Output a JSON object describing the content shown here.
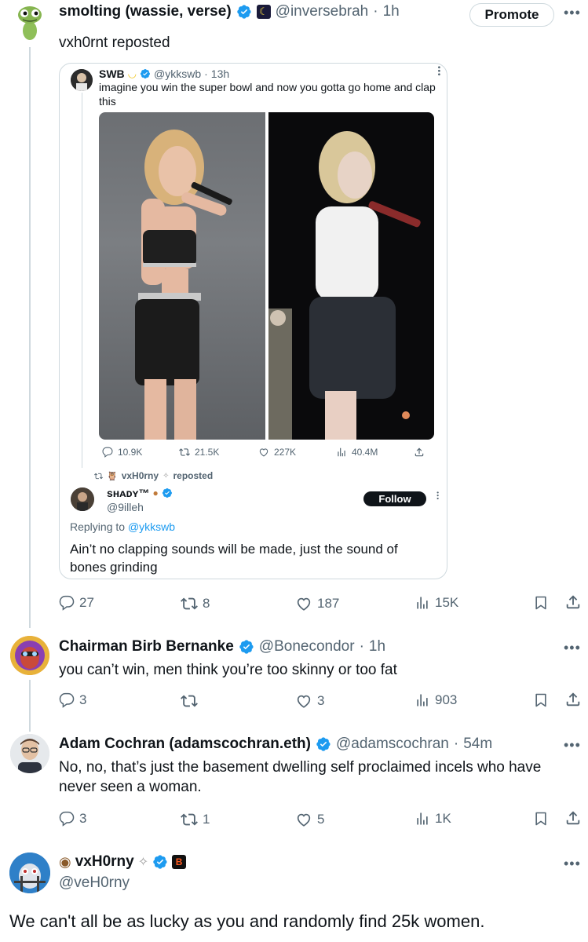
{
  "post1": {
    "author_name": "smolting (wassie, verse)",
    "handle": "@inversebrah",
    "time": "1h",
    "promote_label": "Promote",
    "text": "vxh0rnt reposted",
    "quote": {
      "author_name": "SWB",
      "handle": "@ykkswb",
      "time": "13h",
      "text": "imagine you win the super bowl and now you gotta go home and clap this",
      "stats": {
        "replies": "10.9K",
        "reposts": "21.5K",
        "likes": "227K",
        "views": "40.4M"
      },
      "repost_by": "vxH0rny",
      "repost_suffix": "reposted",
      "reply": {
        "author_name": "sʜᴀᴅʏ™",
        "handle": "@9illeh",
        "follow_label": "Follow",
        "replying_prefix": "Replying to",
        "replying_to": "@ykkswb",
        "text": "Ain’t no clapping sounds will be made, just the sound of bones grinding"
      }
    },
    "stats": {
      "replies": "27",
      "reposts": "8",
      "likes": "187",
      "views": "15K"
    }
  },
  "post2": {
    "author_name": "Chairman Birb Bernanke",
    "handle": "@Bonecondor",
    "time": "1h",
    "text": "you can’t win, men think you’re too skinny or too fat",
    "stats": {
      "replies": "3",
      "reposts": "",
      "likes": "3",
      "views": "903"
    }
  },
  "post3": {
    "author_name": "Adam Cochran (adamscochran.eth)",
    "handle": "@adamscochran",
    "time": "54m",
    "text": "No, no, that’s just the basement dwelling self proclaimed incels who have never seen a woman.",
    "stats": {
      "replies": "3",
      "reposts": "1",
      "likes": "5",
      "views": "1K"
    }
  },
  "post4": {
    "author_name": "vxH0rny",
    "handle": "@veH0rny",
    "text": "We can't all be as lucky as you and randomly find 25k women."
  },
  "colors": {
    "accent": "#1d9bf0",
    "muted": "#536471",
    "border": "#cfd9de",
    "text": "#0f1419"
  },
  "icons": [
    "reply-icon",
    "repost-icon",
    "like-icon",
    "views-icon",
    "bookmark-icon",
    "share-icon",
    "verified-icon",
    "more-icon"
  ]
}
